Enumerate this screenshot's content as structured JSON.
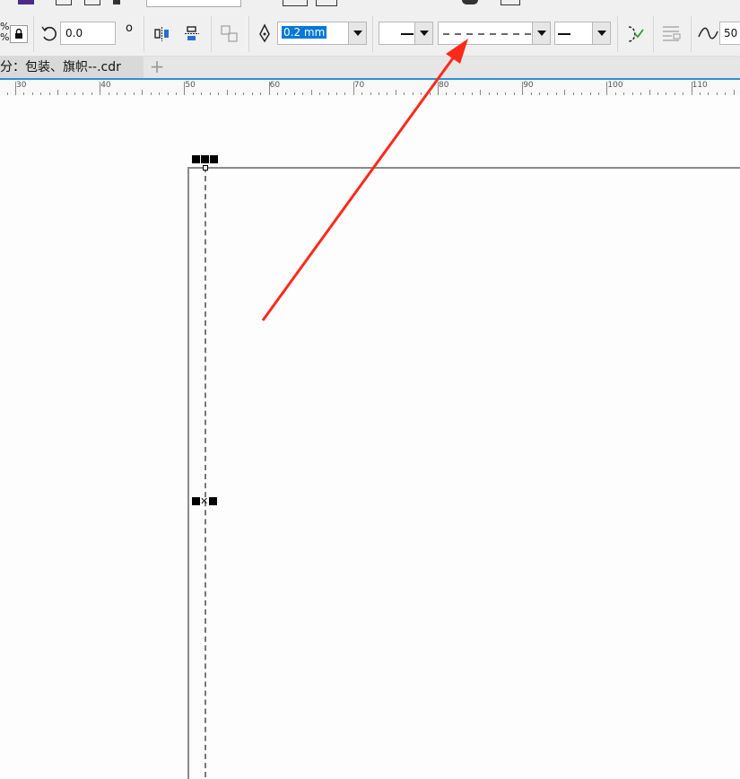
{
  "toolbar": {
    "rotation_value": "0.0",
    "outline_width_value": "0.2 mm",
    "percent_symbol": "%",
    "degree_symbol": "o",
    "curve_value": "50"
  },
  "document": {
    "tab_title": "分：包装、旗帜--.cdr",
    "add_tab_symbol": "+"
  },
  "ruler": {
    "labels": [
      "30",
      "40",
      "50",
      "60",
      "70",
      "80",
      "90",
      "100",
      "110"
    ]
  },
  "colors": {
    "arrow": "#ff2a1a",
    "ruler_accent": "#2c8fd6",
    "selection_highlight": "#0078d7"
  }
}
